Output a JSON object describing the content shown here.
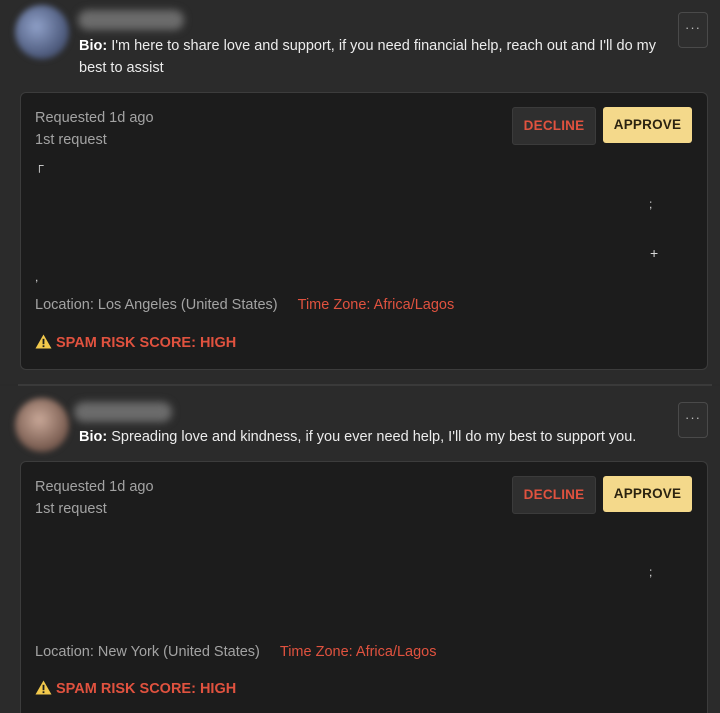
{
  "requests": [
    {
      "bio_label": "Bio:",
      "bio_text": "I'm here to share love and support, if you need financial help, reach out and I'll do my best to assist",
      "more_label": "···",
      "requested": "Requested 1d ago",
      "request_count": "1st request",
      "decline_label": "DECLINE",
      "approve_label": "APPROVE",
      "location": "Location: Los Angeles (United States)",
      "time_zone": "Time Zone: Africa/Lagos",
      "spam_risk": "SPAM RISK SCORE: HIGH"
    },
    {
      "bio_label": "Bio:",
      "bio_text": "Spreading love and kindness, if you ever need help, I'll do my best to support you.",
      "more_label": "···",
      "requested": "Requested 1d ago",
      "request_count": "1st request",
      "decline_label": "DECLINE",
      "approve_label": "APPROVE",
      "location": "Location: New York (United States)",
      "time_zone": "Time Zone: Africa/Lagos",
      "spam_risk": "SPAM RISK SCORE: HIGH"
    }
  ],
  "icons": {
    "warning": "warning-icon",
    "more": "more-options-icon"
  },
  "colors": {
    "page_bg": "#2b2b2b",
    "card_bg": "#1c1c1c",
    "danger": "#e0523f",
    "approve_bg": "#f4d98b",
    "warning_icon": "#f2c94c"
  }
}
